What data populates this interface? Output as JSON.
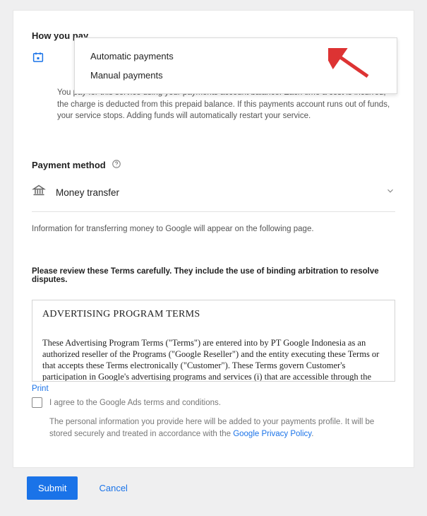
{
  "howPay": {
    "heading": "How you pay",
    "description": "You pay for this service using your payments account balance. Each time a cost is incurred, the charge is deducted from this prepaid balance. If this payments account runs out of funds, your service stops. Adding funds will automatically restart your service."
  },
  "popover": {
    "options": [
      {
        "label": "Automatic payments"
      },
      {
        "label": "Manual payments"
      }
    ]
  },
  "paymentMethod": {
    "heading": "Payment method",
    "selected": "Money transfer",
    "hint": "Information for transferring money to Google will appear on the following page."
  },
  "terms": {
    "notice": "Please review these Terms carefully. They include the use of binding arbitration to resolve disputes.",
    "title": "ADVERTISING PROGRAM TERMS",
    "body": "These Advertising Program Terms (\"Terms\") are entered into by PT Google Indonesia as an authorized reseller of the Programs (\"Google Reseller\") and the entity executing these Terms or that accepts these Terms electronically (\"Customer\").  These Terms govern Customer's participation in Google's advertising programs and services (i) that are accessible through the",
    "printLabel": "Print",
    "agreeLabel": "I agree to the Google Ads terms and conditions.",
    "privacyPrefix": "The personal information you provide here will be added to your payments profile. It will be stored securely and treated in accordance with the ",
    "privacyLinkText": "Google Privacy Policy",
    "privacySuffix": "."
  },
  "footer": {
    "submit": "Submit",
    "cancel": "Cancel"
  }
}
